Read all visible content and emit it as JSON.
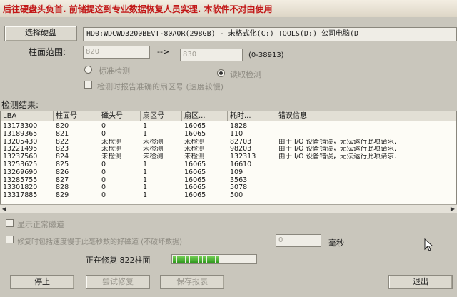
{
  "warning": {
    "text": "后往硬盘头负首. 前储提这到专业数据恢复人员实理. 本软件不对由使用"
  },
  "select_disk": {
    "label": "选择硬盘"
  },
  "disk_info": {
    "text": "HD0:WDCWD3200BEVT-80A0R(298GB) - 未格式化(C:) TOOLS(D:) 公司电脑(D"
  },
  "range": {
    "label": "柱面范围:",
    "from": "820",
    "arrow": "-->",
    "to": "830",
    "limit": "(0-38913)"
  },
  "mode": {
    "standard": "标准检测",
    "read": "读取检测",
    "selected": "read"
  },
  "report_option": {
    "label": "检测时报告准确的扇区号 (速度较慢)"
  },
  "results_label": "检测结果:",
  "columns": [
    "LBA",
    "柱面号",
    "磁头号",
    "扇区号",
    "扇区...",
    "耗时...",
    "错误信息"
  ],
  "rows": [
    {
      "lba": "13173300",
      "cyl": "820",
      "head": "0",
      "sector": "1",
      "count": "16065",
      "time": "1828",
      "error": ""
    },
    {
      "lba": "13189365",
      "cyl": "821",
      "head": "0",
      "sector": "1",
      "count": "16065",
      "time": "110",
      "error": ""
    },
    {
      "lba": "13205430",
      "cyl": "822",
      "head": "未检测",
      "sector": "未检测",
      "count": "未检测",
      "time": "82703",
      "error": "由于 I/O 设备错误，无法运行此项请求."
    },
    {
      "lba": "13221495",
      "cyl": "823",
      "head": "未检测",
      "sector": "未检测",
      "count": "未检测",
      "time": "98203",
      "error": "由于 I/O 设备错误，无法运行此项请求."
    },
    {
      "lba": "13237560",
      "cyl": "824",
      "head": "未检测",
      "sector": "未检测",
      "count": "未检测",
      "time": "132313",
      "error": "由于 I/O 设备错误，无法运行此项请求."
    },
    {
      "lba": "13253625",
      "cyl": "825",
      "head": "0",
      "sector": "1",
      "count": "16065",
      "time": "16610",
      "error": ""
    },
    {
      "lba": "13269690",
      "cyl": "826",
      "head": "0",
      "sector": "1",
      "count": "16065",
      "time": "109",
      "error": ""
    },
    {
      "lba": "13285755",
      "cyl": "827",
      "head": "0",
      "sector": "1",
      "count": "16065",
      "time": "3563",
      "error": ""
    },
    {
      "lba": "13301820",
      "cyl": "828",
      "head": "0",
      "sector": "1",
      "count": "16065",
      "time": "5078",
      "error": ""
    },
    {
      "lba": "13317885",
      "cyl": "829",
      "head": "0",
      "sector": "1",
      "count": "16065",
      "time": "500",
      "error": ""
    }
  ],
  "show_normal": {
    "label": "显示正常磁道"
  },
  "repair_option": {
    "label": "修复时包括速度慢于此毫秒数的好磁道 (不破坏数据)",
    "value": "0",
    "unit": "毫秒"
  },
  "status": {
    "text": "正在修复 822柱面"
  },
  "progress": {
    "fraction": 0.6
  },
  "buttons": {
    "stop": "停止",
    "try_repair": "尝试修复",
    "save_report": "保存报表",
    "exit": "退出"
  },
  "colors": {
    "warning": "#c21818",
    "progress": "#3fae2a"
  }
}
